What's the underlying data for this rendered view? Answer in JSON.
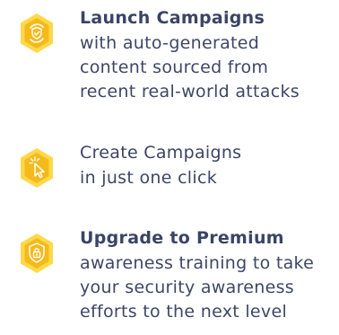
{
  "colors": {
    "hex_outer": "#fdd84a",
    "hex_inner": "#f6b91a",
    "icon_line": "#ffffff",
    "text": "#3d4766"
  },
  "features": [
    {
      "icon": "shield-sync-icon",
      "title": "Launch Campaigns",
      "lines": [
        "with auto-generated",
        "content sourced from",
        "recent real-world attacks"
      ]
    },
    {
      "icon": "click-cursor-icon",
      "title": "Create Campaigns",
      "lines": [
        "in just one click"
      ]
    },
    {
      "icon": "shield-lock-icon",
      "title": "Upgrade to Premium",
      "lines": [
        "awareness training to take",
        "your security awareness",
        "efforts to the next level"
      ]
    }
  ]
}
